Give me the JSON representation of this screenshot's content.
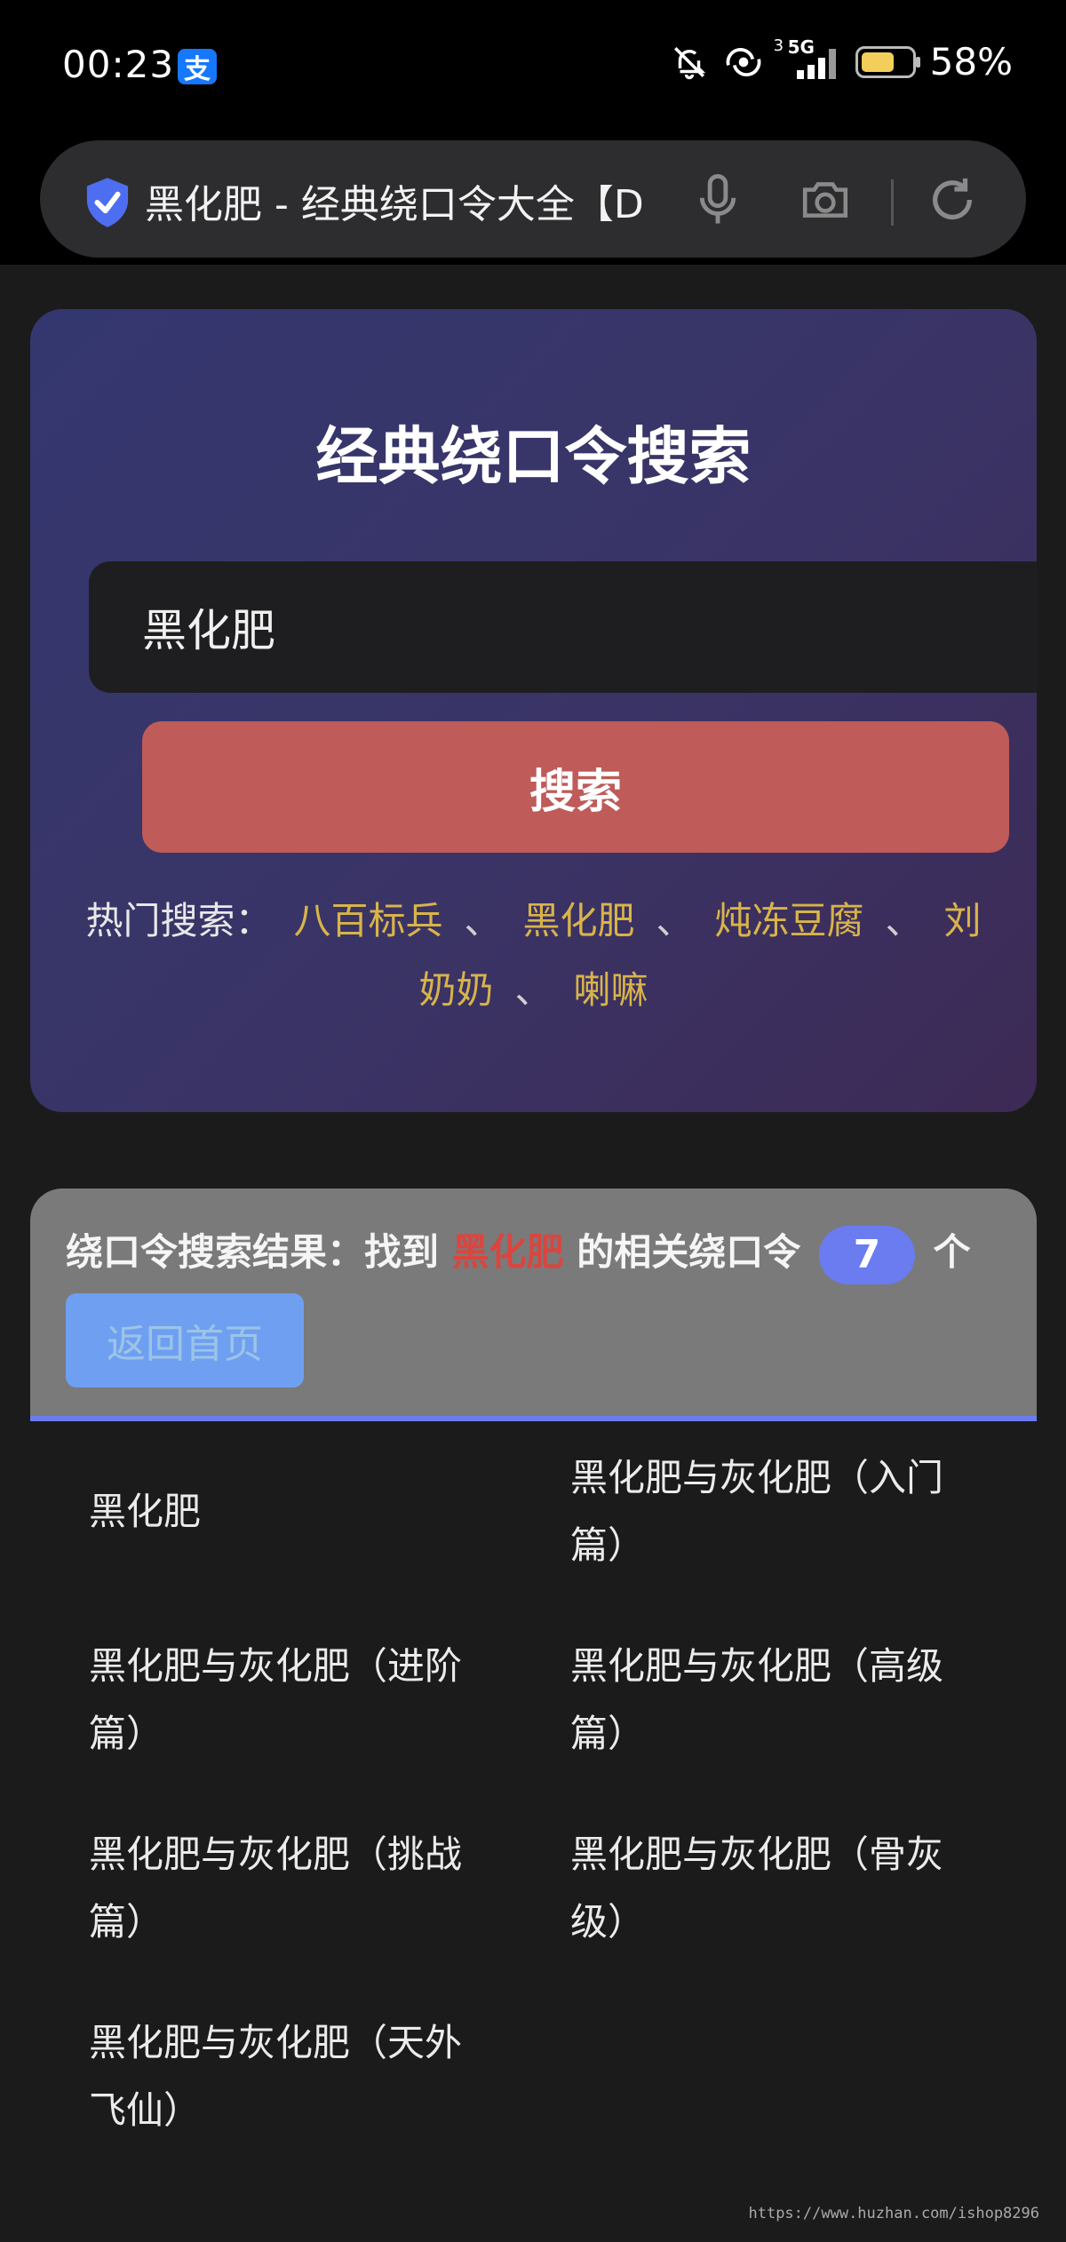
{
  "status_bar": {
    "time": "00:23",
    "app_badge": "支",
    "network": "5G",
    "sim_index": "3",
    "battery": "58%",
    "battery_level": 0.58,
    "icons": [
      "mute-bell-icon",
      "hotspot-icon",
      "signal-icon",
      "battery-icon"
    ]
  },
  "address_bar": {
    "title": "黑化肥 - 经典绕口令大全【D",
    "icons": [
      "shield-check-icon",
      "mic-icon",
      "camera-icon",
      "reload-icon"
    ]
  },
  "hero": {
    "title": "经典绕口令搜索",
    "search_value": "黑化肥",
    "search_button": "搜索",
    "hot_label": "热门搜索：",
    "hot_keywords": [
      "八百标兵",
      "黑化肥",
      "炖冻豆腐",
      "刘奶奶",
      "喇嘛"
    ],
    "separator": "、"
  },
  "results": {
    "prefix": "绕口令搜索结果：找到",
    "term": "黑化肥",
    "middle": "的相关绕口令",
    "count": "7",
    "suffix": "个",
    "home_button": "返回首页",
    "items": [
      "黑化肥",
      "黑化肥与灰化肥（入门篇）",
      "黑化肥与灰化肥（进阶篇）",
      "黑化肥与灰化肥（高级篇）",
      "黑化肥与灰化肥（挑战篇）",
      "黑化肥与灰化肥（骨灰级）",
      "黑化肥与灰化肥（天外飞仙）"
    ]
  },
  "watermark": "https://www.huzhan.com/ishop8296",
  "colors": {
    "accent": "#6b7cf0",
    "search_button": "#bf5b59",
    "keyword": "#d8b44a",
    "term_highlight": "#d9463f"
  }
}
